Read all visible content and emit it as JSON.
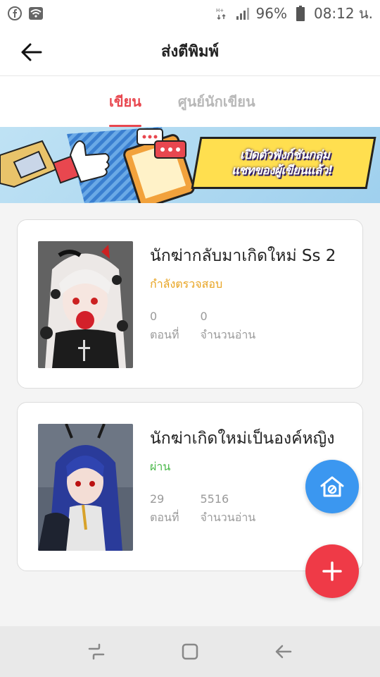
{
  "status_bar": {
    "battery": "96%",
    "time": "08:12 น."
  },
  "header": {
    "title": "ส่งตีพิมพ์"
  },
  "tabs": [
    {
      "label": "เขียน",
      "active": true
    },
    {
      "label": "ศูนย์นักเขียน",
      "active": false
    }
  ],
  "banner": {
    "line1": "เปิดตัวฟังก์ชันกลุ่ม",
    "line2": "แชทของผู้เขียนแล้ว!"
  },
  "novels": [
    {
      "title": "นักฆ่ากลับมาเกิดใหม่  Ss 2",
      "status": "กำลังตรวจสอบ",
      "status_color": "#e8a31f",
      "episodes": "0",
      "episodes_label": "ตอนที่",
      "reads": "0",
      "reads_label": "จำนวนอ่าน"
    },
    {
      "title": "นักฆ่าเกิดใหม่เป็นองค์หญิง",
      "status": "ผ่าน",
      "status_color": "#4ab84a",
      "episodes": "29",
      "episodes_label": "ตอนที่",
      "reads": "5516",
      "reads_label": "จำนวนอ่าน"
    }
  ],
  "colors": {
    "accent": "#e8474f",
    "fab_blue": "#3b97f0",
    "fab_red": "#ef3a47"
  },
  "icons": {
    "back": "arrow-left-icon",
    "community": "community-home-icon",
    "add": "plus-icon"
  }
}
